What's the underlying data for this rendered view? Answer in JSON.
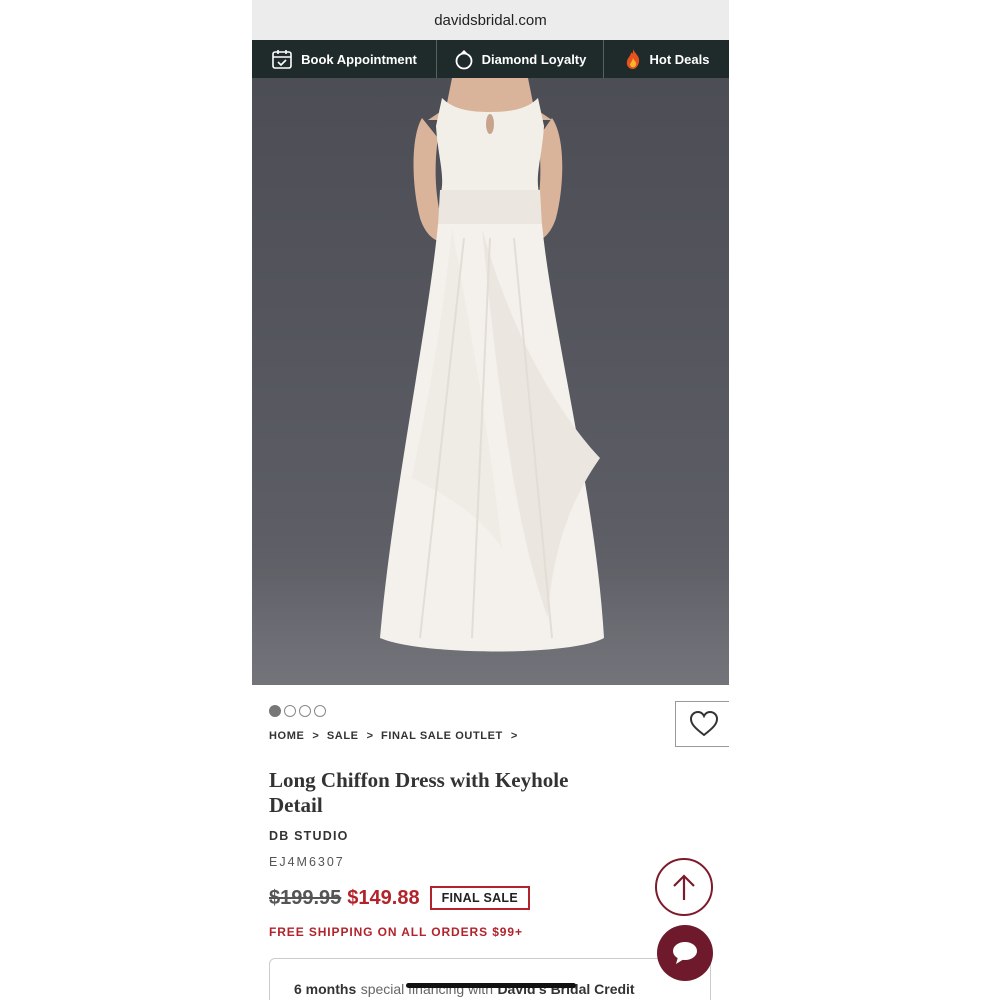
{
  "browser": {
    "url": "davidsbridal.com"
  },
  "nav": {
    "items": [
      {
        "label": "Book Appointment",
        "icon": "calendar-check-icon"
      },
      {
        "label": "Diamond Loyalty",
        "icon": "ring-icon"
      },
      {
        "label": "Hot Deals",
        "icon": "flame-icon"
      }
    ]
  },
  "hero": {
    "image": "product photo of long white chiffon dress on model"
  },
  "carousel": {
    "total": 4,
    "active": 1
  },
  "breadcrumb": [
    "HOME",
    "SALE",
    "FINAL SALE OUTLET"
  ],
  "breadcrumb_sep": ">",
  "product": {
    "title": "Long Chiffon Dress with Keyhole Detail",
    "brand": "DB STUDIO",
    "sku": "EJ4M6307",
    "price_was": "$199.95",
    "price_now": "$149.88",
    "badge": "FINAL SALE",
    "shipping": "FREE SHIPPING ON ALL ORDERS $99+"
  },
  "financing": {
    "lead": "6 months",
    "middle": "special financing with",
    "tail": "David's Bridal Credit"
  },
  "colors": {
    "accent_red": "#b3232b",
    "nav_bg": "#1f2a2b",
    "chat_bg": "#6e1a2c"
  },
  "buttons": {
    "wishlist_icon": "heart-icon",
    "back_to_top_icon": "arrow-up-icon",
    "chat_icon": "chat-bubble-icon"
  }
}
